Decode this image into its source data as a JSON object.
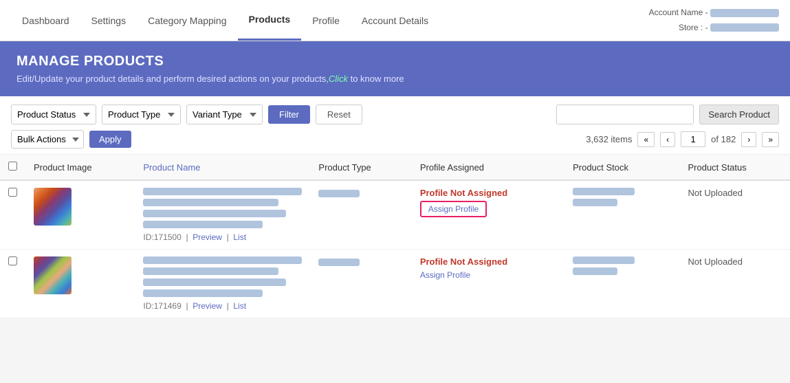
{
  "nav": {
    "links": [
      {
        "label": "Dashboard",
        "active": false
      },
      {
        "label": "Settings",
        "active": false
      },
      {
        "label": "Category Mapping",
        "active": false
      },
      {
        "label": "Products",
        "active": true
      },
      {
        "label": "Profile",
        "active": false
      },
      {
        "label": "Account Details",
        "active": false
      }
    ]
  },
  "account": {
    "name_label": "Account Name -",
    "store_label": "Store : -"
  },
  "hero": {
    "title": "MANAGE PRODUCTS",
    "description": "Edit/Update your product details and perform desired actions on your products,",
    "link_text": "Click",
    "description_suffix": " to know more"
  },
  "filters": {
    "product_status_label": "Product Status",
    "product_type_label": "Product Type",
    "variant_type_label": "Variant Type",
    "filter_btn": "Filter",
    "reset_btn": "Reset",
    "bulk_actions_label": "Bulk Actions",
    "apply_btn": "Apply",
    "search_placeholder": "",
    "search_btn": "Search Product",
    "items_count": "3,632 items",
    "current_page": "1",
    "total_pages": "of 182"
  },
  "table": {
    "headers": [
      {
        "label": "",
        "key": "checkbox"
      },
      {
        "label": "Product Image",
        "key": "image"
      },
      {
        "label": "Product Name",
        "key": "name",
        "sortable": true
      },
      {
        "label": "Product Type",
        "key": "type"
      },
      {
        "label": "Profile Assigned",
        "key": "profile"
      },
      {
        "label": "Product Stock",
        "key": "stock"
      },
      {
        "label": "Product Status",
        "key": "status"
      }
    ],
    "rows": [
      {
        "id": "171500",
        "image_type": "1",
        "name_lines": [
          100,
          85,
          90,
          75
        ],
        "type_width": 60,
        "profile_status": "Profile Not Assigned",
        "assign_label": "Assign Profile",
        "assign_highlighted": true,
        "stock_lines": [
          90,
          65
        ],
        "status": "Not Uploaded",
        "preview_label": "Preview",
        "list_label": "List"
      },
      {
        "id": "171469",
        "image_type": "2",
        "name_lines": [
          100,
          85,
          90,
          75
        ],
        "type_width": 60,
        "profile_status": "Profile Not Assigned",
        "assign_label": "Assign Profile",
        "assign_highlighted": false,
        "stock_lines": [
          90,
          65
        ],
        "status": "Not Uploaded",
        "preview_label": "Preview",
        "list_label": "List"
      }
    ]
  }
}
